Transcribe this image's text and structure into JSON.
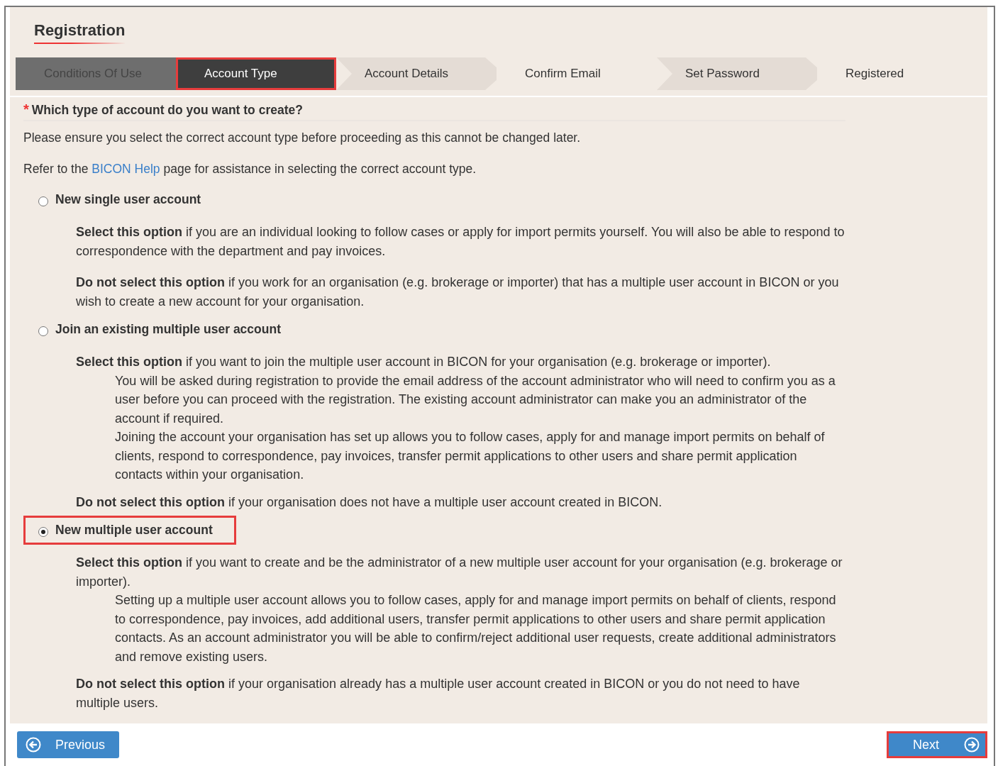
{
  "title": "Registration",
  "steps": [
    {
      "label": "Conditions Of Use",
      "kind": "done",
      "selected": false,
      "highlighted": false
    },
    {
      "label": "Account Type",
      "kind": "current",
      "selected": true,
      "highlighted": true
    },
    {
      "label": "Account Details",
      "kind": "upcoming",
      "selected": false,
      "highlighted": false
    },
    {
      "label": "Confirm Email",
      "kind": "upcoming",
      "selected": false,
      "highlighted": false
    },
    {
      "label": "Set Password",
      "kind": "upcoming",
      "selected": false,
      "highlighted": false
    },
    {
      "label": "Registered",
      "kind": "upcoming",
      "selected": false,
      "highlighted": false
    }
  ],
  "question": {
    "required_mark": "*",
    "text": "Which type of account do you want to create?"
  },
  "intro": "Please ensure you select the correct account type before proceeding as this cannot be changed later.",
  "help": {
    "before": "Refer to the",
    "link": "BICON Help",
    "after": "page for assistance in selecting the correct account type."
  },
  "options": [
    {
      "label": "New single user account",
      "selected": false,
      "highlighted": false,
      "blocks": [
        {
          "kind": "para",
          "lines": [
            "**Select this option** if you are an individual looking to follow cases or apply for import permits yourself. You will also be able to respond to correspondence with the department and pay invoices."
          ]
        },
        {
          "kind": "para",
          "lines": [
            "**Do not select this option** if you work for an organisation (e.g. brokerage or importer) that has a multiple user account in BICON or you wish to create a new account for your organisation."
          ]
        }
      ]
    },
    {
      "label": "Join an existing multiple user account",
      "selected": false,
      "highlighted": false,
      "blocks": [
        {
          "kind": "para",
          "lines": [
            "**Select this option** if you want to join the multiple user account in BICON for your organisation (e.g. brokerage or importer)."
          ]
        },
        {
          "kind": "indent",
          "lines": [
            "You will be asked during registration to provide the email address of the account administrator who will need to confirm you as a user before you can proceed with the registration. The existing account administrator can make you an administrator of the account if required.",
            "Joining the account your organisation has set up allows you to follow cases, apply for and manage import permits on behalf of clients, respond to correspondence, pay invoices, transfer permit applications to other users and share permit application contacts within your organisation."
          ]
        },
        {
          "kind": "para",
          "lines": [
            "**Do not select this option** if your organisation does not have a multiple user account created in BICON."
          ]
        }
      ]
    },
    {
      "label": "New multiple user account",
      "selected": true,
      "highlighted": true,
      "blocks": [
        {
          "kind": "para",
          "lines": [
            "**Select this option** if you want to create and be the administrator of a new multiple user account for your organisation (e.g. brokerage or importer)."
          ]
        },
        {
          "kind": "indent",
          "lines": [
            "Setting up a multiple user account allows you to follow cases, apply for and manage import permits on behalf of clients, respond to correspondence, pay invoices, add additional users, transfer permit applications to other users and share permit application contacts. As an account administrator you will be able to confirm/reject additional user requests, create additional administrators and remove existing users."
          ]
        },
        {
          "kind": "para",
          "lines": [
            "**Do not select this option** if your organisation already has a multiple user account created in BICON or you do not need to have multiple users."
          ]
        }
      ]
    }
  ],
  "buttons": [
    {
      "label": "Previous",
      "kind": "back",
      "highlighted": false
    },
    {
      "label": "Next",
      "kind": "forward",
      "highlighted": true
    }
  ]
}
